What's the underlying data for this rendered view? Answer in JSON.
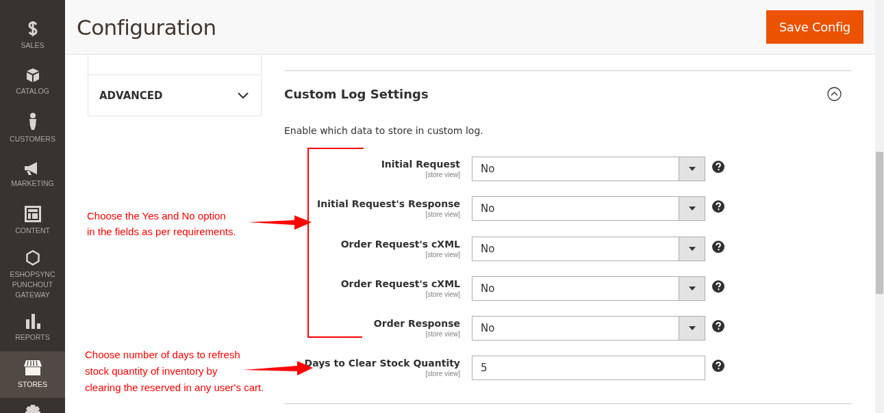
{
  "sidebar": {
    "items": [
      {
        "label": "SALES",
        "selected": false
      },
      {
        "label": "CATALOG",
        "selected": false
      },
      {
        "label": "CUSTOMERS",
        "selected": false
      },
      {
        "label": "MARKETING",
        "selected": false
      },
      {
        "label": "CONTENT",
        "selected": false
      },
      {
        "label": "ESHOPSYNC PUNCHOUT GATEWAY",
        "selected": false
      },
      {
        "label": "REPORTS",
        "selected": false
      },
      {
        "label": "STORES",
        "selected": true
      }
    ]
  },
  "header": {
    "title": "Configuration",
    "save_button": "Save Config"
  },
  "config_tabs": [
    {
      "label": "ADVANCED",
      "expanded": false
    }
  ],
  "section": {
    "title": "Custom Log Settings",
    "expanded": true,
    "description": "Enable which data to store in custom log.",
    "fields": [
      {
        "label": "Initial Request",
        "scope": "[store view]",
        "kind": "select",
        "value": "No"
      },
      {
        "label": "Initial Request's Response",
        "scope": "[store view]",
        "kind": "select",
        "value": "No"
      },
      {
        "label": "Order Request's cXML",
        "scope": "[store view]",
        "kind": "select",
        "value": "No"
      },
      {
        "label": "Order Request's cXML",
        "scope": "[store view]",
        "kind": "select",
        "value": "No"
      },
      {
        "label": "Order Response",
        "scope": "[store view]",
        "kind": "select",
        "value": "No"
      },
      {
        "label": "Days to Clear Stock Quantity",
        "scope": "[store view]",
        "kind": "text",
        "value": "5"
      }
    ]
  },
  "annotations": [
    {
      "text": "Choose the Yes and No option\nin the fields as per requirements."
    },
    {
      "text": "Choose number of days to refresh\nstock quantity of inventory by\nclearing the reserved in any user's cart."
    }
  ]
}
